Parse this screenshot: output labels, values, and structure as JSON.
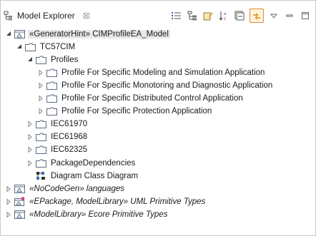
{
  "view": {
    "title": "Model Explorer",
    "close_symbol": "☒"
  },
  "toolbar": [
    {
      "name": "show-list-icon"
    },
    {
      "name": "hierarchy-icon"
    },
    {
      "name": "edit-icon"
    },
    {
      "name": "sort-az-icon"
    },
    {
      "name": "collapse-all-icon"
    },
    {
      "name": "link-with-editor-icon"
    },
    {
      "name": "view-menu-icon"
    },
    {
      "name": "minimize-icon"
    },
    {
      "name": "maximize-icon"
    }
  ],
  "tree": [
    {
      "label": "«GeneratorHint» CIMProfileEA_Model",
      "expanded": true,
      "level": 0,
      "icon": "model-icon",
      "selected": true
    },
    {
      "label": "TC57CIM",
      "expanded": true,
      "level": 1,
      "icon": "package-icon"
    },
    {
      "label": "Profiles",
      "expanded": true,
      "level": 2,
      "icon": "package-icon"
    },
    {
      "label": "Profile For Specific Modeling and Simulation Application",
      "expanded": false,
      "level": 3,
      "icon": "package-icon"
    },
    {
      "label": "Profile For Specific Monotoring and Diagnostic Application",
      "expanded": false,
      "level": 3,
      "icon": "package-icon"
    },
    {
      "label": "Profile For Specific Distributed Control Application",
      "expanded": false,
      "level": 3,
      "icon": "package-icon"
    },
    {
      "label": "Profile For Specific Protection Application",
      "expanded": false,
      "level": 3,
      "icon": "package-icon"
    },
    {
      "label": "IEC61970",
      "expanded": false,
      "level": 2,
      "icon": "package-icon"
    },
    {
      "label": "IEC61968",
      "expanded": false,
      "level": 2,
      "icon": "package-icon"
    },
    {
      "label": "IEC62325",
      "expanded": false,
      "level": 2,
      "icon": "package-icon"
    },
    {
      "label": "PackageDependencies",
      "expanded": false,
      "level": 2,
      "icon": "package-icon"
    },
    {
      "label": "Diagram Class Diagram",
      "expanded": null,
      "level": 2,
      "icon": "diagram-icon"
    },
    {
      "label": "«NoCodeGen» languages",
      "expanded": false,
      "level": 0,
      "icon": "model-icon",
      "italic": true
    },
    {
      "label": "«EPackage, ModelLibrary» UML Primitive Types",
      "expanded": false,
      "level": 0,
      "icon": "model-library-icon",
      "italic": true
    },
    {
      "label": "«ModelLibrary» Ecore Primitive Types",
      "expanded": false,
      "level": 0,
      "icon": "model-icon",
      "italic": true
    }
  ]
}
